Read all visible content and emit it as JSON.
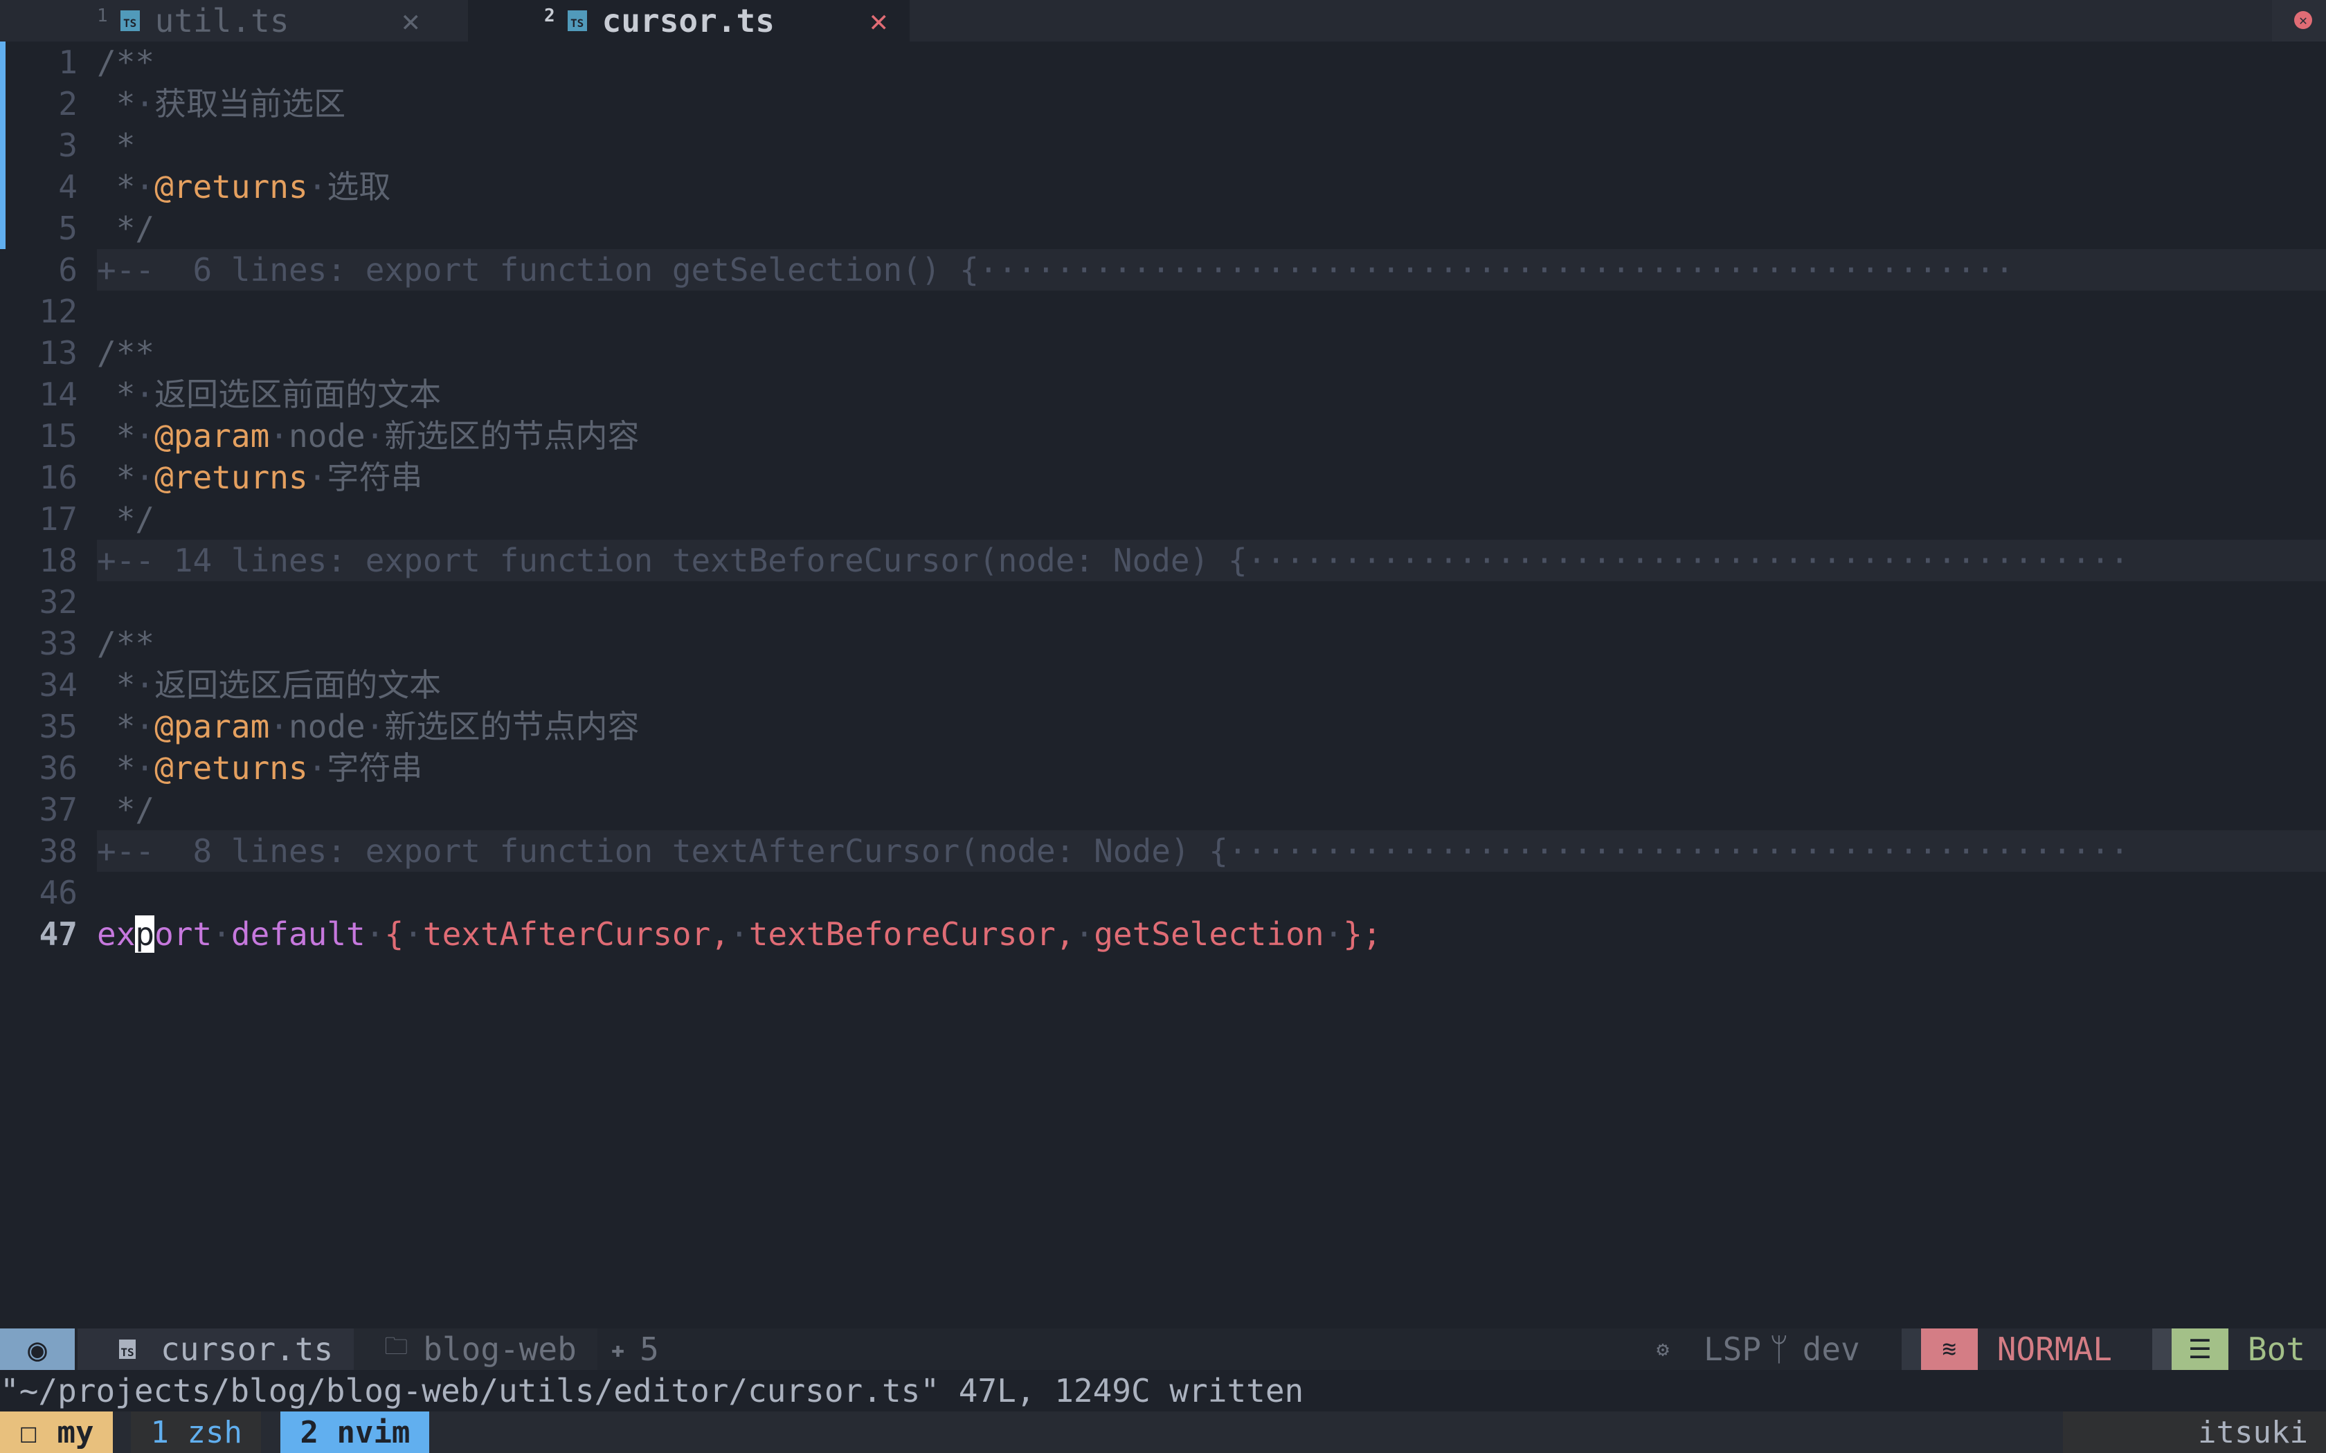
{
  "tabs": [
    {
      "num": "1",
      "icon": "ts-icon",
      "label": "util.ts",
      "close": "✕",
      "active": false
    },
    {
      "num": "2",
      "icon": "ts-icon",
      "label": "cursor.ts",
      "close": "✕",
      "active": true
    }
  ],
  "close_all_icon": "✕",
  "editor": {
    "current_line": "47",
    "lines": [
      {
        "n": "1",
        "seg": [
          [
            "c-comment",
            "/**"
          ]
        ]
      },
      {
        "n": "2",
        "seg": [
          [
            "c-comment",
            " *"
          ],
          [
            "c-ws",
            "·"
          ],
          [
            "c-comment",
            "获取当前选区"
          ]
        ]
      },
      {
        "n": "3",
        "seg": [
          [
            "c-comment",
            " *"
          ]
        ]
      },
      {
        "n": "4",
        "seg": [
          [
            "c-comment",
            " *"
          ],
          [
            "c-ws",
            "·"
          ],
          [
            "c-tag",
            "@returns"
          ],
          [
            "c-ws",
            "·"
          ],
          [
            "c-comment",
            "选取"
          ]
        ]
      },
      {
        "n": "5",
        "seg": [
          [
            "c-comment",
            " */"
          ]
        ]
      },
      {
        "n": "6",
        "fold": true,
        "seg": [
          [
            "c-fold",
            "+--  6 lines: export function getSelection() {······················································"
          ]
        ]
      },
      {
        "n": "12",
        "seg": []
      },
      {
        "n": "13",
        "seg": [
          [
            "c-comment",
            "/**"
          ]
        ]
      },
      {
        "n": "14",
        "seg": [
          [
            "c-comment",
            " *"
          ],
          [
            "c-ws",
            "·"
          ],
          [
            "c-comment",
            "返回选区前面的文本"
          ]
        ]
      },
      {
        "n": "15",
        "seg": [
          [
            "c-comment",
            " *"
          ],
          [
            "c-ws",
            "·"
          ],
          [
            "c-tag",
            "@param"
          ],
          [
            "c-ws",
            "·"
          ],
          [
            "c-comment",
            "node"
          ],
          [
            "c-ws",
            "·"
          ],
          [
            "c-comment",
            "新选区的节点内容"
          ]
        ]
      },
      {
        "n": "16",
        "seg": [
          [
            "c-comment",
            " *"
          ],
          [
            "c-ws",
            "·"
          ],
          [
            "c-tag",
            "@returns"
          ],
          [
            "c-ws",
            "·"
          ],
          [
            "c-comment",
            "字符串"
          ]
        ]
      },
      {
        "n": "17",
        "seg": [
          [
            "c-comment",
            " */"
          ]
        ]
      },
      {
        "n": "18",
        "fold": true,
        "seg": [
          [
            "c-fold",
            "+-- 14 lines: export function textBeforeCursor(node: Node) {··············································"
          ]
        ]
      },
      {
        "n": "32",
        "seg": []
      },
      {
        "n": "33",
        "seg": [
          [
            "c-comment",
            "/**"
          ]
        ]
      },
      {
        "n": "34",
        "seg": [
          [
            "c-comment",
            " *"
          ],
          [
            "c-ws",
            "·"
          ],
          [
            "c-comment",
            "返回选区后面的文本"
          ]
        ]
      },
      {
        "n": "35",
        "seg": [
          [
            "c-comment",
            " *"
          ],
          [
            "c-ws",
            "·"
          ],
          [
            "c-tag",
            "@param"
          ],
          [
            "c-ws",
            "·"
          ],
          [
            "c-comment",
            "node"
          ],
          [
            "c-ws",
            "·"
          ],
          [
            "c-comment",
            "新选区的节点内容"
          ]
        ]
      },
      {
        "n": "36",
        "seg": [
          [
            "c-comment",
            " *"
          ],
          [
            "c-ws",
            "·"
          ],
          [
            "c-tag",
            "@returns"
          ],
          [
            "c-ws",
            "·"
          ],
          [
            "c-comment",
            "字符串"
          ]
        ]
      },
      {
        "n": "37",
        "seg": [
          [
            "c-comment",
            " */"
          ]
        ]
      },
      {
        "n": "38",
        "fold": true,
        "seg": [
          [
            "c-fold",
            "+--  8 lines: export function textAfterCursor(node: Node) {···············································"
          ]
        ]
      },
      {
        "n": "46",
        "seg": []
      },
      {
        "n": "47",
        "seg": [
          [
            "c-kw",
            "ex"
          ],
          [
            "c-kw cursor",
            "p"
          ],
          [
            "c-kw",
            "ort"
          ],
          [
            "c-ws",
            "·"
          ],
          [
            "c-kw",
            "default"
          ],
          [
            "c-ws",
            "·"
          ],
          [
            "c-punc",
            "{"
          ],
          [
            "c-ws",
            "·"
          ],
          [
            "c-id",
            "textAfterCursor,"
          ],
          [
            "c-ws",
            "·"
          ],
          [
            "c-id",
            "textBeforeCursor,"
          ],
          [
            "c-ws",
            "·"
          ],
          [
            "c-id",
            "getSelection"
          ],
          [
            "c-ws",
            "·"
          ],
          [
            "c-punc",
            "};"
          ]
        ]
      }
    ]
  },
  "statusline": {
    "mode_icon": "◉",
    "file_icon": "ts-icon",
    "file": "cursor.ts",
    "folder_icon": "🗀",
    "dir": "blog-web",
    "diag_icon": "✚",
    "diag_count": "5",
    "lsp_icon": "⚙",
    "lsp": "LSP",
    "branch_icon": "ᛘ",
    "branch": "dev",
    "vim_mode_icon": "≋",
    "vim_mode": "NORMAL",
    "pos_icon": "☰",
    "position": "Bot"
  },
  "cmdline": "\"~/projects/blog/blog-web/utils/editor/cursor.ts\" 47L, 1249C written",
  "tmux": {
    "session_icon": "☐",
    "session": "my",
    "windows": [
      {
        "label": "1 zsh",
        "active": false
      },
      {
        "label": "2 nvim",
        "active": true
      }
    ],
    "host": "itsuki"
  },
  "colors": {
    "bg": "#1e222a",
    "accent_blue": "#61afef",
    "normal_mode": "#d47d85",
    "bot": "#a3c088",
    "tmux_session": "#e8c07d"
  }
}
